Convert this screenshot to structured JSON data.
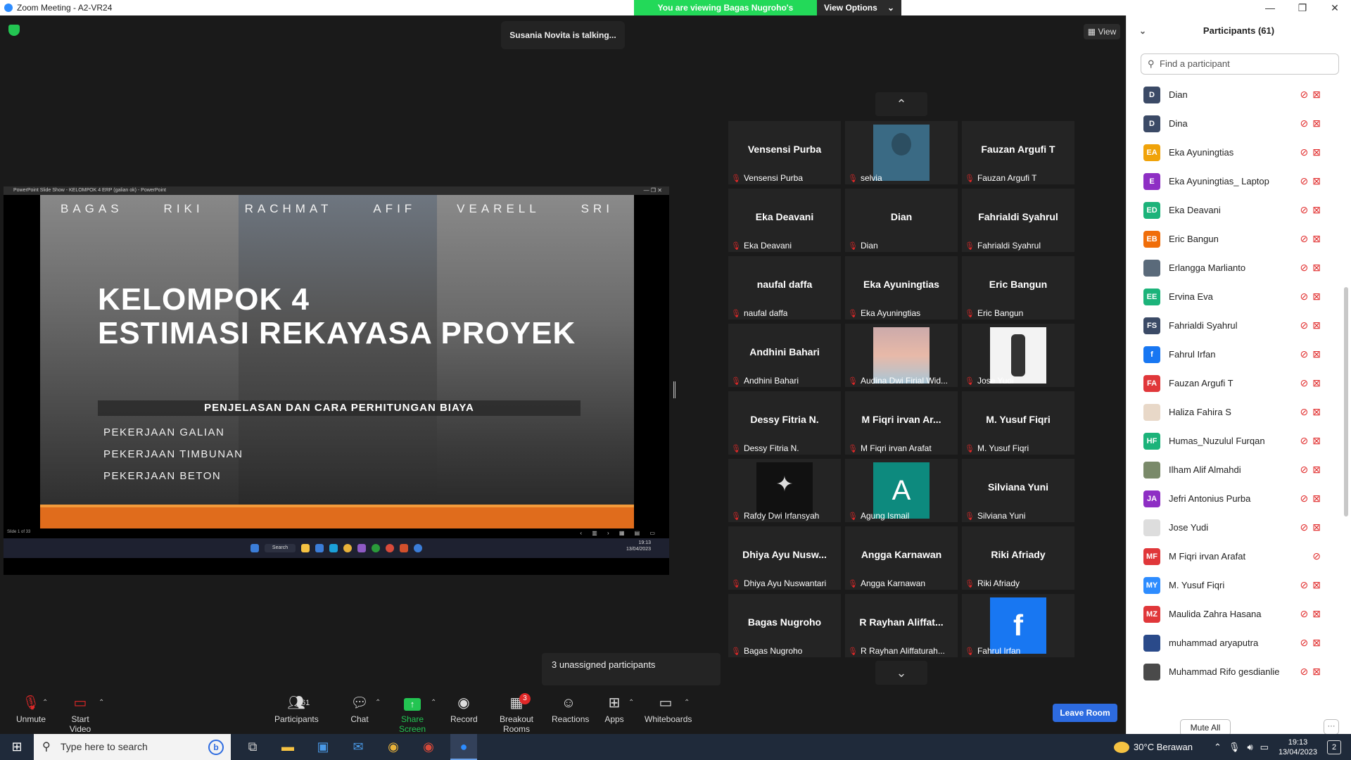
{
  "window": {
    "title": "Zoom Meeting - A2-VR24",
    "controls": [
      "—",
      "❐",
      "✕"
    ]
  },
  "banner": {
    "viewing_text": "You are viewing Bagas Nugroho's screen",
    "view_options_label": "View Options",
    "caret": "⌄"
  },
  "meeting": {
    "talking_text": "Susania Novita is talking...",
    "view_label": "View",
    "unassigned_text": "3 unassigned participants"
  },
  "shared_screen": {
    "window_title": "PowerPoint Slide Show - KELOMPOK 4 ERP (galian ok) - PowerPoint",
    "window_controls": "— ❐ ✕",
    "slide": {
      "names": [
        "BAGAS",
        "RIKI",
        "RACHMAT",
        "AFIF",
        "VEARELL",
        "SRI"
      ],
      "title_line1": "KELOMPOK 4",
      "title_line2": "ESTIMASI REKAYASA PROYEK",
      "subtitle": "PENJELASAN DAN CARA PERHITUNGAN BIAYA",
      "bullets": [
        "PEKERJAAN GALIAN",
        "PEKERJAAN TIMBUNAN",
        "PEKERJAAN BETON"
      ]
    },
    "status_text": "Slide 1 of 33",
    "nav": "‹ ▥ › ▦ ▤ ▭",
    "taskbar_search": "Search",
    "clock_time": "19:13",
    "clock_date": "13/04/2023"
  },
  "gallery": {
    "tiles": [
      {
        "title": "Vensensi Purba",
        "name": "Vensensi Purba",
        "photo": ""
      },
      {
        "title": "",
        "name": "selvia",
        "photo": "person"
      },
      {
        "title": "Fauzan Argufi T",
        "name": "Fauzan Argufi T",
        "photo": ""
      },
      {
        "title": "Eka Deavani",
        "name": "Eka Deavani",
        "photo": ""
      },
      {
        "title": "Dian",
        "name": "Dian",
        "photo": ""
      },
      {
        "title": "Fahrialdi Syahrul",
        "name": "Fahrialdi Syahrul",
        "photo": ""
      },
      {
        "title": "naufal daffa",
        "name": "naufal daffa",
        "photo": ""
      },
      {
        "title": "Eka Ayuningtias",
        "name": "Eka Ayuningtias",
        "photo": ""
      },
      {
        "title": "Eric Bangun",
        "name": "Eric Bangun",
        "photo": ""
      },
      {
        "title": "Andhini Bahari",
        "name": "Andhini Bahari",
        "photo": ""
      },
      {
        "title": "",
        "name": "Audina Dwi Firial Wid...",
        "photo": "girl"
      },
      {
        "title": "",
        "name": "Jose Yudi",
        "photo": "man"
      },
      {
        "title": "Dessy Fitria N.",
        "name": "Dessy Fitria N.",
        "photo": ""
      },
      {
        "title": "M Fiqri irvan Ar...",
        "name": "M Fiqri irvan Arafat",
        "photo": ""
      },
      {
        "title": "M. Yusuf Fiqri",
        "name": "M. Yusuf Fiqri",
        "photo": ""
      },
      {
        "title": "",
        "name": "Rafdy Dwi Irfansyah",
        "photo": "logo"
      },
      {
        "title": "",
        "name": "Agung Ismail",
        "photo": "A"
      },
      {
        "title": "Silviana Yuni",
        "name": "Silviana Yuni",
        "photo": ""
      },
      {
        "title": "Dhiya Ayu Nusw...",
        "name": "Dhiya Ayu Nuswantari",
        "photo": ""
      },
      {
        "title": "Angga Karnawan",
        "name": "Angga Karnawan",
        "photo": ""
      },
      {
        "title": "Riki Afriady",
        "name": "Riki Afriady",
        "photo": ""
      },
      {
        "title": "Bagas Nugroho",
        "name": "Bagas Nugroho",
        "photo": ""
      },
      {
        "title": "R Rayhan Aliffat...",
        "name": "R Rayhan Aliffaturah...",
        "photo": ""
      },
      {
        "title": "",
        "name": "Fahrul Irfan",
        "photo": "f"
      }
    ]
  },
  "toolbar": {
    "unmute": "Unmute",
    "start_video": "Start Video",
    "participants": "Participants",
    "participants_count": "61",
    "chat": "Chat",
    "share_screen": "Share Screen",
    "record": "Record",
    "breakout_rooms": "Breakout Rooms",
    "breakout_badge": "3",
    "reactions": "Reactions",
    "apps": "Apps",
    "whiteboards": "Whiteboards",
    "leave_room": "Leave Room"
  },
  "participants_panel": {
    "title": "Participants (61)",
    "search_placeholder": "Find a participant",
    "mute_all": "Mute All",
    "more": "···",
    "items": [
      {
        "initials": "D",
        "name": "Dian",
        "color": "#3b4a66",
        "video_off": true
      },
      {
        "initials": "D",
        "name": "Dina",
        "color": "#3b4a66",
        "video_off": true
      },
      {
        "initials": "EA",
        "name": "Eka Ayuningtias",
        "color": "#f0a30a",
        "video_off": true
      },
      {
        "initials": "E",
        "name": "Eka Ayuningtias_ Laptop",
        "color": "#8e2fc4",
        "video_off": true
      },
      {
        "initials": "ED",
        "name": "Eka Deavani",
        "color": "#1cb37a",
        "video_off": true
      },
      {
        "initials": "EB",
        "name": "Eric Bangun",
        "color": "#f06e0a",
        "video_off": true
      },
      {
        "initials": "",
        "name": "Erlangga Marlianto",
        "color": "#5a6a7a",
        "video_off": true
      },
      {
        "initials": "EE",
        "name": "Ervina Eva",
        "color": "#1cb37a",
        "video_off": true
      },
      {
        "initials": "FS",
        "name": "Fahrialdi Syahrul",
        "color": "#3b4a66",
        "video_off": true
      },
      {
        "initials": "f",
        "name": "Fahrul Irfan",
        "color": "#1877f2",
        "video_off": true
      },
      {
        "initials": "FA",
        "name": "Fauzan Argufi T",
        "color": "#e0373a",
        "video_off": true
      },
      {
        "initials": "",
        "name": "Haliza Fahira S",
        "color": "#e8d8c8",
        "video_off": true
      },
      {
        "initials": "HF",
        "name": "Humas_Nuzulul Furqan",
        "color": "#1cb37a",
        "video_off": true
      },
      {
        "initials": "",
        "name": "Ilham Alif Almahdi",
        "color": "#7a8a6a",
        "video_off": true
      },
      {
        "initials": "JA",
        "name": "Jefri Antonius Purba",
        "color": "#8e2fc4",
        "video_off": true
      },
      {
        "initials": "",
        "name": "Jose Yudi",
        "color": "#dddddd",
        "video_off": true
      },
      {
        "initials": "MF",
        "name": "M Fiqri irvan Arafat",
        "color": "#e0373a",
        "video_off": false
      },
      {
        "initials": "MY",
        "name": "M. Yusuf Fiqri",
        "color": "#2d8cff",
        "video_off": true
      },
      {
        "initials": "MZ",
        "name": "Maulida Zahra Hasana",
        "color": "#e0373a",
        "video_off": true
      },
      {
        "initials": "",
        "name": "muhammad aryaputra",
        "color": "#2a4a8a",
        "video_off": true
      },
      {
        "initials": "",
        "name": "Muhammad Rifo gesdianlie",
        "color": "#4a4a4a",
        "video_off": true
      }
    ]
  },
  "taskbar": {
    "search_placeholder": "Type here to search",
    "weather": "30°C Berawan",
    "time": "19:13",
    "date": "13/04/2023",
    "notifications": "2"
  }
}
